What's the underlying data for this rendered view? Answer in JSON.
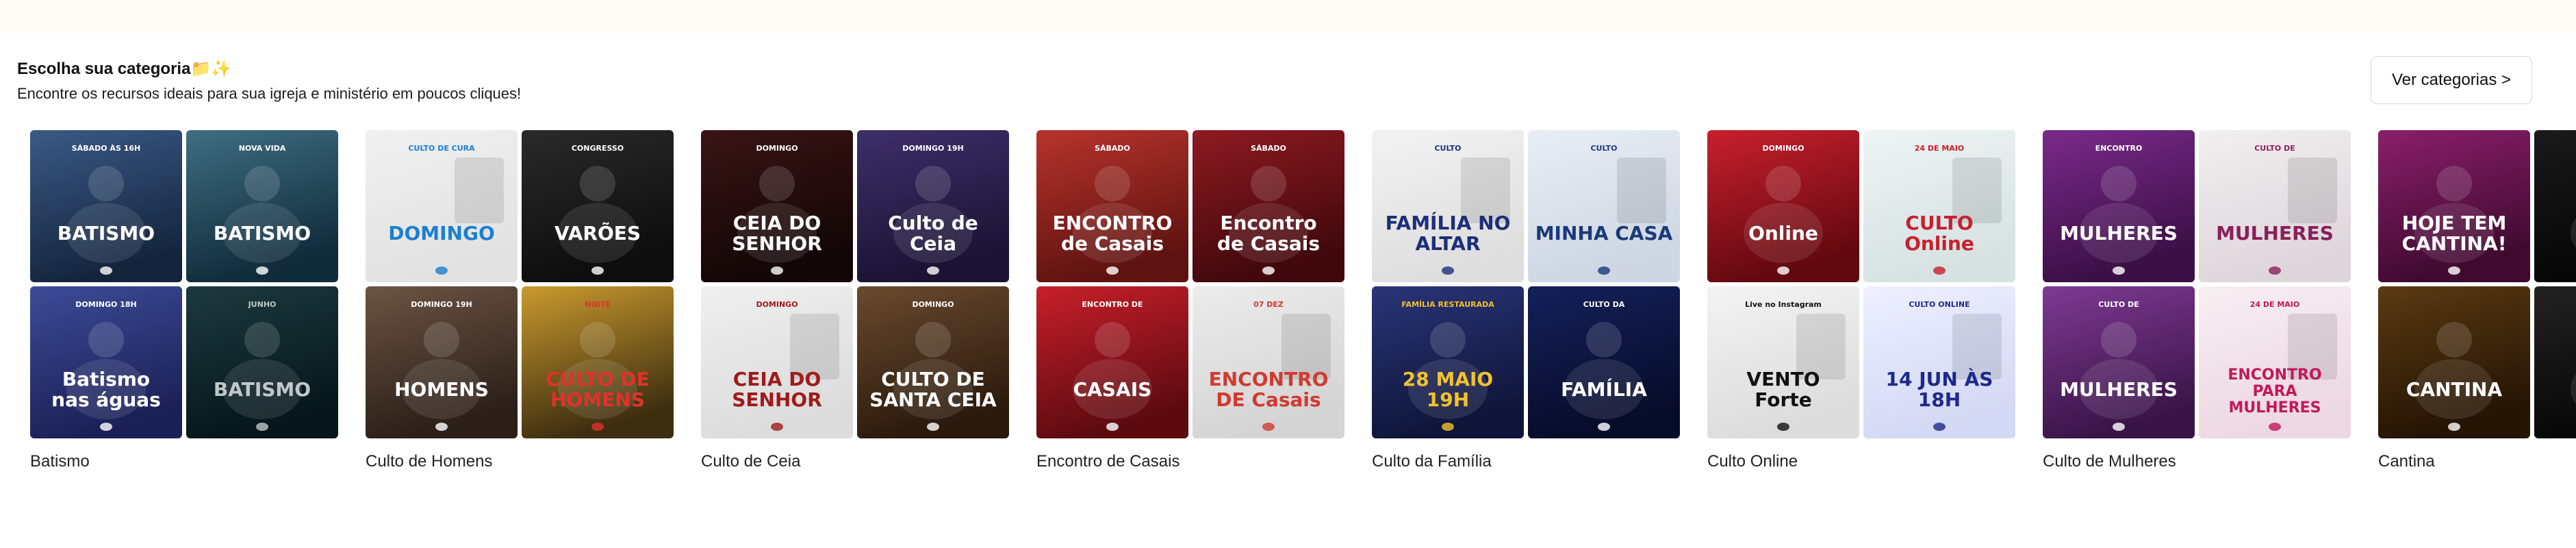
{
  "section": {
    "title": "Escolha sua categoria📁✨",
    "subtitle": "Encontre os recursos ideais para sua igreja e ministério em poucos cliques!",
    "button_label": "Ver categorias >"
  },
  "categories": [
    {
      "label": "Batismo",
      "thumbs": [
        {
          "bg": "#3a5a86",
          "bg2": "#14243d",
          "accent": "#ffffff",
          "big": "BATISMO",
          "small": "SÁBADO ÀS 16H",
          "style": "photo"
        },
        {
          "bg": "#3f6e82",
          "bg2": "#102b3a",
          "accent": "#ffffff",
          "big": "BATISMO",
          "small": "NOVA VIDA",
          "style": "photo"
        },
        {
          "bg": "#3d4b97",
          "bg2": "#1b2156",
          "accent": "#ffffff",
          "big": "Batismo nas águas",
          "small": "DOMINGO 18H",
          "style": "photo"
        },
        {
          "bg": "#1c3a40",
          "bg2": "#06161a",
          "accent": "#bfc8c9",
          "big": "BATISMO",
          "small": "JUNHO",
          "style": "dark"
        }
      ]
    },
    {
      "label": "Culto de Homens",
      "thumbs": [
        {
          "bg": "#f0f0f0",
          "bg2": "#e2e2e2",
          "accent": "#1b7fd1",
          "big": "DOMINGO",
          "small": "CULTO DE CURA",
          "style": "light"
        },
        {
          "bg": "#2a2a2a",
          "bg2": "#0d0d0d",
          "accent": "#ffffff",
          "big": "VARÕES",
          "small": "CONGRESSO",
          "style": "dark"
        },
        {
          "bg": "#6b5444",
          "bg2": "#2b1f18",
          "accent": "#ffffff",
          "big": "HOMENS",
          "small": "DOMINGO 19H",
          "style": "photo"
        },
        {
          "bg": "#c99a2e",
          "bg2": "#3d2e10",
          "accent": "#e0322a",
          "big": "CULTO DE HOMENS",
          "small": "NOITE",
          "style": "photo"
        }
      ]
    },
    {
      "label": "Culto de Ceia",
      "thumbs": [
        {
          "bg": "#3a1414",
          "bg2": "#120606",
          "accent": "#ffffff",
          "big": "CEIA DO SENHOR",
          "small": "DOMINGO",
          "style": "dark"
        },
        {
          "bg": "#3e2f6a",
          "bg2": "#1a1333",
          "accent": "#ffffff",
          "big": "Culto de Ceia",
          "small": "DOMINGO 19H",
          "style": "dark"
        },
        {
          "bg": "#efefef",
          "bg2": "#dcdcdc",
          "accent": "#a01a1a",
          "big": "CEIA DO SENHOR",
          "small": "DOMINGO",
          "style": "light"
        },
        {
          "bg": "#6a4a2e",
          "bg2": "#2a1a0d",
          "accent": "#ffffff",
          "big": "CULTO DE SANTA CEIA",
          "small": "DOMINGO",
          "style": "photo"
        }
      ]
    },
    {
      "label": "Encontro de Casais",
      "thumbs": [
        {
          "bg": "#b8332c",
          "bg2": "#5e1310",
          "accent": "#ffffff",
          "big": "ENCONTRO de Casais",
          "small": "SÁBADO",
          "style": "photo"
        },
        {
          "bg": "#8e1a22",
          "bg2": "#40080c",
          "accent": "#ffffff",
          "big": "Encontro de Casais",
          "small": "SÁBADO",
          "style": "photo"
        },
        {
          "bg": "#c81f2b",
          "bg2": "#5c0a10",
          "accent": "#ffffff",
          "big": "CASAIS",
          "small": "ENCONTRO DE",
          "style": "photo"
        },
        {
          "bg": "#ececec",
          "bg2": "#d4d4d4",
          "accent": "#d23a2f",
          "big": "ENCONTRO DE Casais",
          "small": "07 DEZ",
          "style": "light"
        }
      ]
    },
    {
      "label": "Culto da Família",
      "thumbs": [
        {
          "bg": "#f2f2f2",
          "bg2": "#dedede",
          "accent": "#1c2f7a",
          "big": "FAMÍLIA NO ALTAR",
          "small": "CULTO",
          "style": "light"
        },
        {
          "bg": "#e9eef5",
          "bg2": "#cdd6e2",
          "accent": "#1c3a7a",
          "big": "MINHA CASA",
          "small": "CULTO",
          "style": "light"
        },
        {
          "bg": "#2a3578",
          "bg2": "#0f1538",
          "accent": "#f2c12e",
          "big": "28 MAIO 19H",
          "small": "FAMÍLIA RESTAURADA",
          "style": "photo"
        },
        {
          "bg": "#15205a",
          "bg2": "#070c29",
          "accent": "#ffffff",
          "big": "FAMÍLIA",
          "small": "CULTO DA",
          "style": "dark"
        }
      ]
    },
    {
      "label": "Culto Online",
      "thumbs": [
        {
          "bg": "#c8202e",
          "bg2": "#62080f",
          "accent": "#ffffff",
          "big": "Online",
          "small": "DOMINGO",
          "style": "photo"
        },
        {
          "bg": "#eef3f3",
          "bg2": "#d6e2e2",
          "accent": "#c8202e",
          "big": "CULTO Online",
          "small": "24 DE MAIO",
          "style": "light"
        },
        {
          "bg": "#f3f3f3",
          "bg2": "#dcdcdc",
          "accent": "#111111",
          "big": "VENTO Forte",
          "small": "Live no Instagram",
          "style": "light"
        },
        {
          "bg": "#eef0ff",
          "bg2": "#d3d8f4",
          "accent": "#1d2a8a",
          "big": "14 JUN ÀS 18H",
          "small": "CULTO ONLINE",
          "style": "light"
        }
      ]
    },
    {
      "label": "Culto de Mulheres",
      "thumbs": [
        {
          "bg": "#7a2a8a",
          "bg2": "#3a0f45",
          "accent": "#ffffff",
          "big": "MULHERES",
          "small": "ENCONTRO",
          "style": "photo"
        },
        {
          "bg": "#f1eff0",
          "bg2": "#ddd6da",
          "accent": "#8a1f5a",
          "big": "MULHERES",
          "small": "CULTO DE",
          "style": "light"
        },
        {
          "bg": "#7e3a92",
          "bg2": "#3a1448",
          "accent": "#ffffff",
          "big": "MULHERES",
          "small": "CULTO DE",
          "style": "photo"
        },
        {
          "bg": "#f7eef2",
          "bg2": "#ecd8e2",
          "accent": "#c2185b",
          "big": "ENCONTRO PARA MULHERES",
          "small": "24 DE MAIO",
          "style": "light"
        }
      ]
    },
    {
      "label": "Cantina",
      "thumbs": [
        {
          "bg": "#8a1f6a",
          "bg2": "#3e0a2e",
          "accent": "#ffffff",
          "big": "HOJE TEM CANTINA!",
          "small": "",
          "style": "photo"
        },
        {
          "bg": "#1a1a1a",
          "bg2": "#050505",
          "accent": "#ffffff",
          "big": "",
          "small": "",
          "style": "dark"
        },
        {
          "bg": "#5a3a12",
          "bg2": "#241404",
          "accent": "#ffffff",
          "big": "CANTINA",
          "small": "",
          "style": "photo"
        },
        {
          "bg": "#222222",
          "bg2": "#060606",
          "accent": "#ffffff",
          "big": "",
          "small": "",
          "style": "dark"
        }
      ]
    }
  ]
}
